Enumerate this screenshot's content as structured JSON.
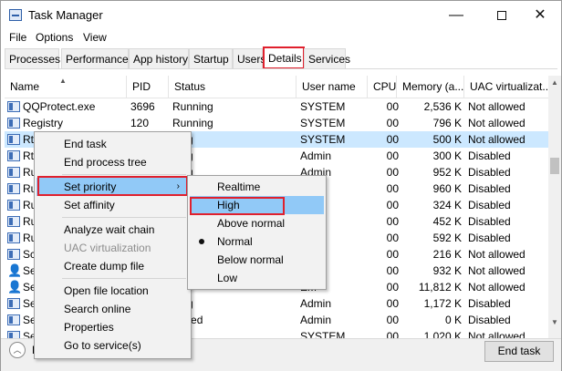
{
  "window": {
    "title": "Task Manager",
    "controls": {
      "minimize": "—",
      "close": "✕"
    }
  },
  "menubar": [
    "File",
    "Options",
    "View"
  ],
  "tabs": [
    "Processes",
    "Performance",
    "App history",
    "Startup",
    "Users",
    "Details",
    "Services"
  ],
  "active_tab": "Details",
  "columns": {
    "name": "Name",
    "pid": "PID",
    "status": "Status",
    "user": "User name",
    "cpu": "CPU",
    "memory": "Memory (a...",
    "uac": "UAC virtualizat..."
  },
  "rows": [
    {
      "name": "QQProtect.exe",
      "pid": "3696",
      "status": "Running",
      "user": "SYSTEM",
      "cpu": "00",
      "memory": "2,536 K",
      "uac": "Not allowed"
    },
    {
      "name": "Registry",
      "pid": "120",
      "status": "Running",
      "user": "SYSTEM",
      "cpu": "00",
      "memory": "796 K",
      "uac": "Not allowed"
    },
    {
      "name": "Rtk",
      "pid": "",
      "status": "ning",
      "user": "SYSTEM",
      "cpu": "00",
      "memory": "500 K",
      "uac": "Not allowed"
    },
    {
      "name": "Rtk",
      "pid": "",
      "status": "ning",
      "user": "Admin",
      "cpu": "00",
      "memory": "300 K",
      "uac": "Disabled"
    },
    {
      "name": "Ru",
      "pid": "",
      "status": "ning",
      "user": "Admin",
      "cpu": "00",
      "memory": "952 K",
      "uac": "Disabled"
    },
    {
      "name": "Ru",
      "pid": "",
      "status": "",
      "user": "n",
      "cpu": "00",
      "memory": "960 K",
      "uac": "Disabled"
    },
    {
      "name": "Ru",
      "pid": "",
      "status": "",
      "user": "n",
      "cpu": "00",
      "memory": "324 K",
      "uac": "Disabled"
    },
    {
      "name": "Ru",
      "pid": "",
      "status": "",
      "user": "n",
      "cpu": "00",
      "memory": "452 K",
      "uac": "Disabled"
    },
    {
      "name": "Ru",
      "pid": "",
      "status": "",
      "user": "n",
      "cpu": "00",
      "memory": "592 K",
      "uac": "Disabled"
    },
    {
      "name": "Sch",
      "pid": "",
      "status": "",
      "user": "EM",
      "cpu": "00",
      "memory": "216 K",
      "uac": "Not allowed"
    },
    {
      "name": "Sea",
      "pid": "",
      "status": "",
      "user": "EM",
      "cpu": "00",
      "memory": "932 K",
      "uac": "Not allowed"
    },
    {
      "name": "Sea",
      "pid": "",
      "status": "",
      "user": "EM",
      "cpu": "00",
      "memory": "11,812 K",
      "uac": "Not allowed"
    },
    {
      "name": "Sea",
      "pid": "",
      "status": "ning",
      "user": "Admin",
      "cpu": "00",
      "memory": "1,172 K",
      "uac": "Disabled"
    },
    {
      "name": "Sea",
      "pid": "",
      "status": "ended",
      "user": "Admin",
      "cpu": "00",
      "memory": "0 K",
      "uac": "Disabled"
    },
    {
      "name": "Se",
      "pid": "",
      "status": "",
      "user": "SYSTEM",
      "cpu": "00",
      "memory": "1,020 K",
      "uac": "Not allowed"
    }
  ],
  "context_menu": {
    "end_task": "End task",
    "end_process_tree": "End process tree",
    "set_priority": "Set priority",
    "set_affinity": "Set affinity",
    "analyze_wait_chain": "Analyze wait chain",
    "uac_virtualization": "UAC virtualization",
    "create_dump_file": "Create dump file",
    "open_file_location": "Open file location",
    "search_online": "Search online",
    "properties": "Properties",
    "go_to_services": "Go to service(s)"
  },
  "priority_submenu": {
    "realtime": "Realtime",
    "high": "High",
    "above_normal": "Above normal",
    "normal": "Normal",
    "below_normal": "Below normal",
    "low": "Low",
    "selected": "Normal"
  },
  "footer": {
    "fewer_details": "F",
    "end_task_button": "End task"
  },
  "colors": {
    "highlight_box": "#e0202d",
    "menu_hover": "#91c9f7",
    "selected_row": "#cce8ff"
  }
}
